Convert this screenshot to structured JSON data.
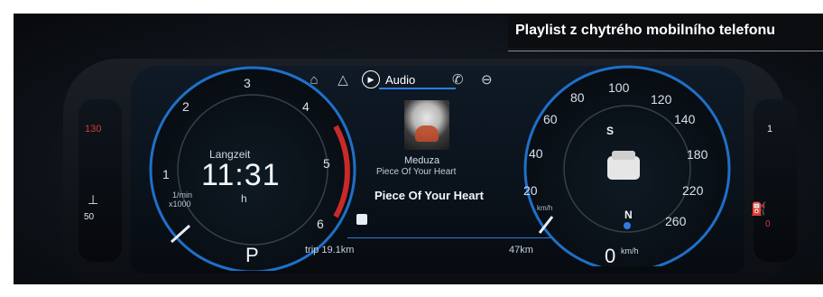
{
  "caption": "Playlist z chytrého mobilního telefonu",
  "left_gauge": {
    "center_label": "Langzeit",
    "time": "11:31",
    "unit": "h",
    "rpm_label_line1": "1/min",
    "rpm_label_line2": "x1000",
    "ticks": [
      "1",
      "2",
      "3",
      "4",
      "5",
      "6"
    ],
    "gear": "P"
  },
  "nav": {
    "audio_label": "Audio",
    "icons": [
      "car-service-icon",
      "navigation-icon",
      "play-circle-icon",
      "phone-icon",
      "car-icon"
    ]
  },
  "media": {
    "artist": "Meduza",
    "track_small": "Piece Of Your Heart",
    "track_big": "Piece Of Your Heart"
  },
  "trip": {
    "left": "trip 19.1km",
    "right": "47km"
  },
  "right_gauge": {
    "ticks": [
      "20",
      "40",
      "60",
      "80",
      "100",
      "120",
      "140",
      "180",
      "220",
      "260"
    ],
    "unit_small": "km/h",
    "speed": "0",
    "speed_unit": "km/h",
    "compass_s": "S",
    "compass_n": "N"
  },
  "left_side_gauge": {
    "top": "130",
    "bottom": "50",
    "icon": "temperature-icon"
  },
  "right_side_gauge": {
    "top": "1",
    "bottom": "0",
    "icon": "fuel-icon"
  },
  "colors": {
    "accent_blue": "#2d7de0",
    "redline": "#d12a2a",
    "text": "#e9eef5"
  }
}
